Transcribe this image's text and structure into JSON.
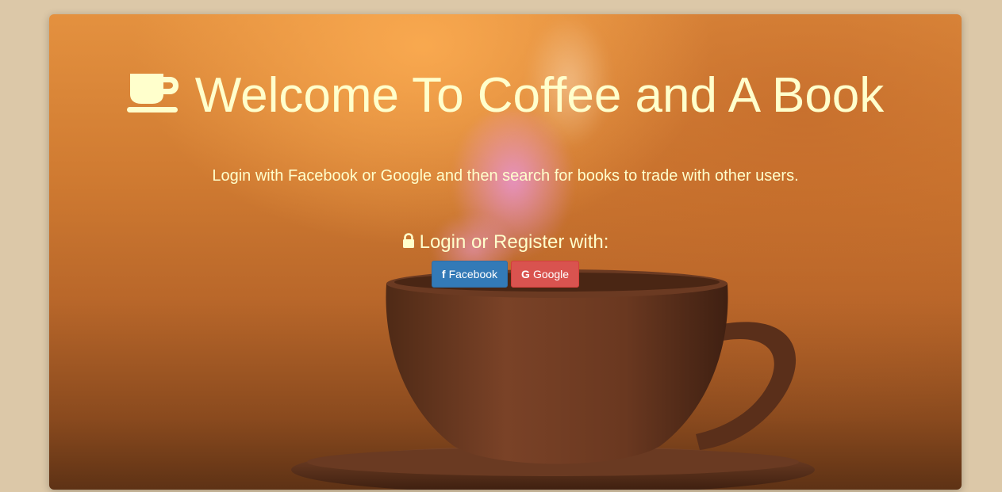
{
  "hero": {
    "title": "Welcome To Coffee and A Book",
    "subtitle": "Login with Facebook or Google and then search for books to trade with other users.",
    "login_heading": "Login or Register with:"
  },
  "buttons": {
    "facebook": {
      "icon": "f",
      "label": "Facebook"
    },
    "google": {
      "icon": "G",
      "label": "Google"
    }
  },
  "icons": {
    "title_icon": "coffee-cup-icon",
    "login_icon": "lock-icon"
  },
  "colors": {
    "text": "#ffffcc",
    "page_background": "#dcc8a8",
    "facebook": "#337ab7",
    "google": "#d9534f"
  }
}
